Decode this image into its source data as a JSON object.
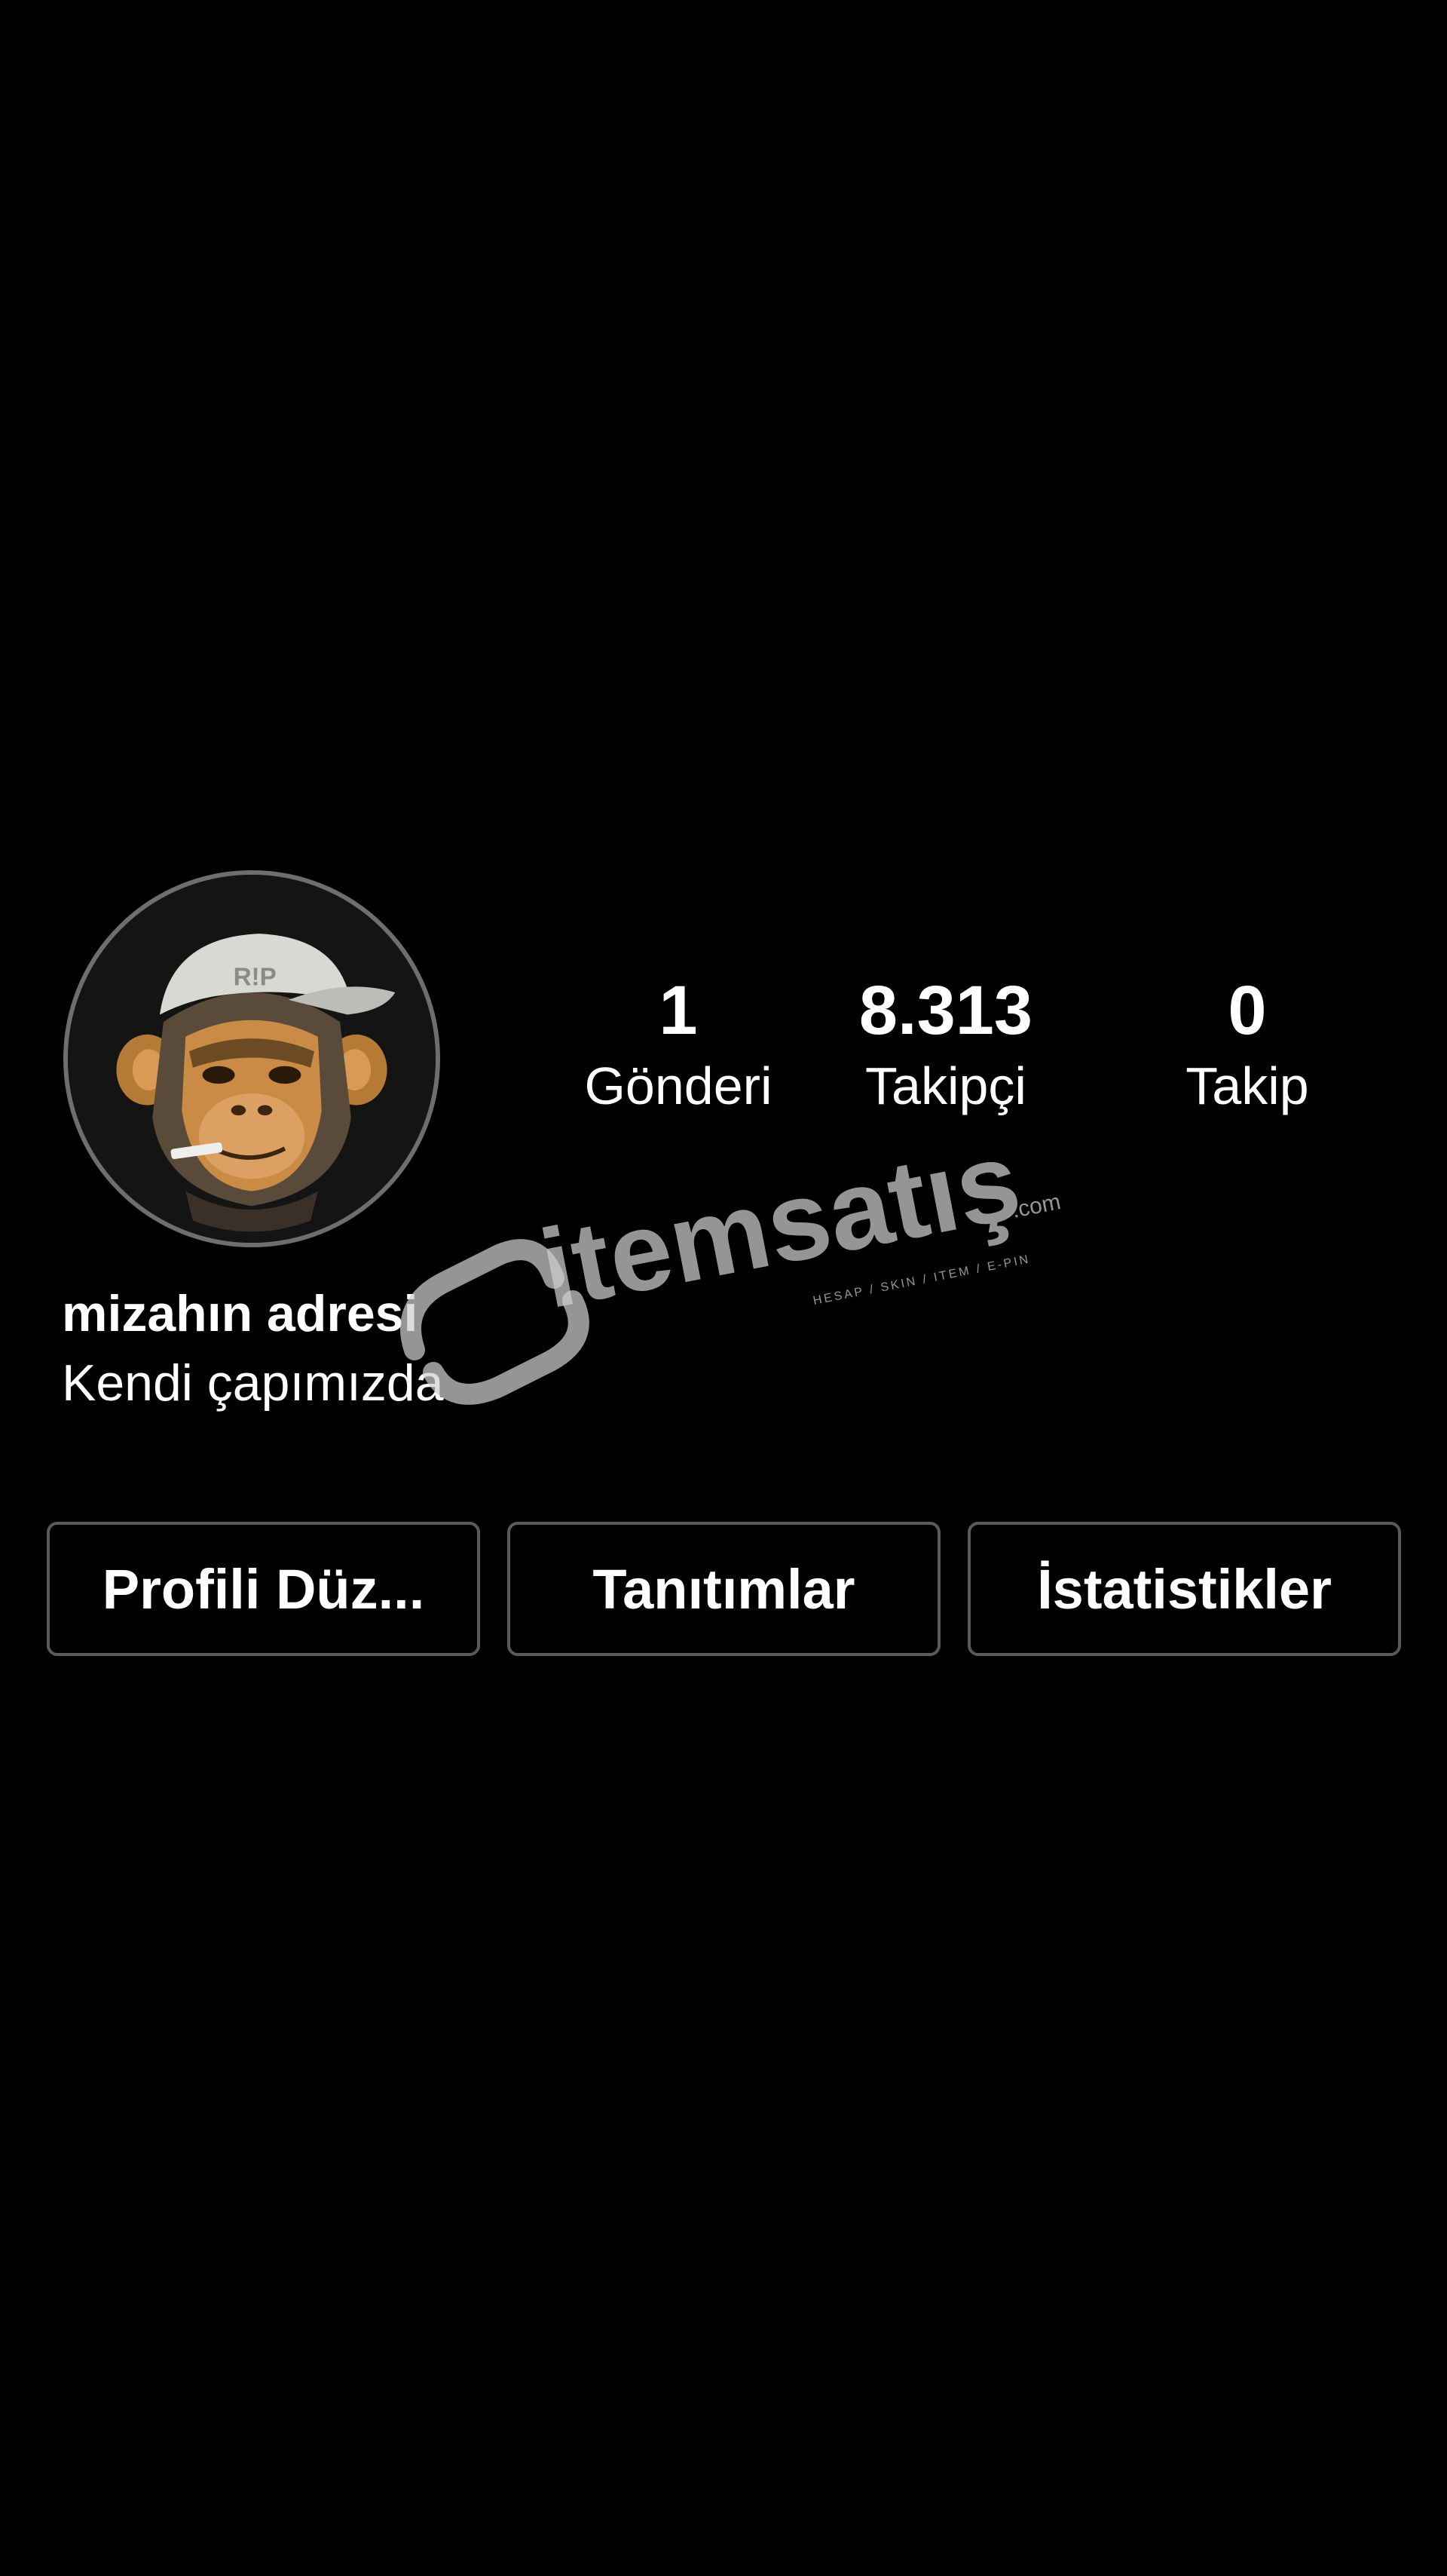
{
  "profile": {
    "display_name": "mizahın adresi",
    "bio": "Kendi çapımızda",
    "avatar": {
      "icon": "monkey-with-cap-icon",
      "cap_text": "R!P"
    }
  },
  "stats": {
    "posts": {
      "value": "1",
      "label": "Gönderi"
    },
    "followers": {
      "value": "8.313",
      "label": "Takipçi"
    },
    "following": {
      "value": "0",
      "label": "Takip"
    }
  },
  "actions": {
    "edit_profile_label": "Profili Düz...",
    "promotions_label": "Tanıtımlar",
    "insights_label": "İstatistikler"
  },
  "watermark": {
    "brand": "itemsatış",
    "domain": ".com",
    "tagline": "HESAP / SKIN / ITEM / E-PIN"
  },
  "colors": {
    "background": "#000000",
    "text": "#ffffff",
    "button_border": "#5a5a5a",
    "watermark": "#cfcfcf"
  }
}
